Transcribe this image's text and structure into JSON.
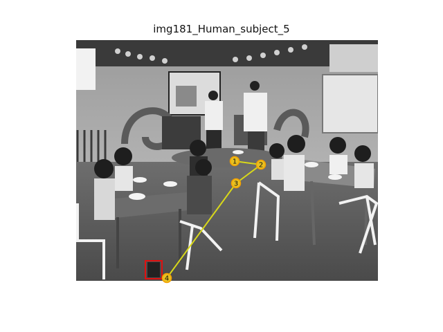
{
  "figure": {
    "title": "img181_Human_subject_5"
  },
  "scanpath": {
    "line_color": "#d8d81a",
    "marker_fill": "#e8c020",
    "marker_edge": "#f4a000",
    "box_color": "#e01010",
    "points": [
      {
        "label": "1"
      },
      {
        "label": "2"
      },
      {
        "label": "3"
      },
      {
        "label": "4"
      }
    ]
  }
}
